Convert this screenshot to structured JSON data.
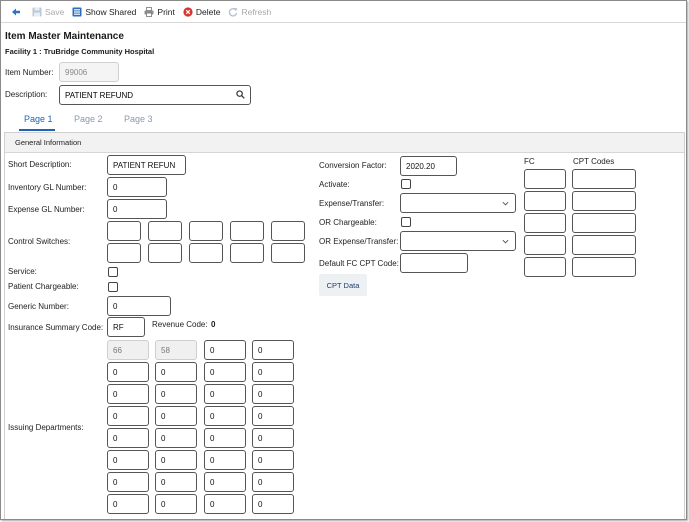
{
  "toolbar": {
    "back_label": "",
    "save_label": "Save",
    "show_shared_label": "Show Shared",
    "print_label": "Print",
    "delete_label": "Delete",
    "refresh_label": "Refresh"
  },
  "header": {
    "title": "Item Master Maintenance",
    "facility": "Facility 1 : TruBridge Community Hospital"
  },
  "item_number": {
    "label": "Item Number:",
    "value": "99006"
  },
  "description": {
    "label": "Description:",
    "value": "PATIENT REFUND"
  },
  "tabs": [
    {
      "label": "Page 1",
      "active": true
    },
    {
      "label": "Page 2",
      "active": false
    },
    {
      "label": "Page 3",
      "active": false
    }
  ],
  "section_title": "General Information",
  "left": {
    "short_description": {
      "label": "Short Description:",
      "value": "PATIENT REFUN"
    },
    "inventory_gl": {
      "label": "Inventory GL Number:",
      "value": "0"
    },
    "expense_gl": {
      "label": "Expense GL Number:",
      "value": "0"
    },
    "control_switches": {
      "label": "Control Switches:",
      "values": [
        "",
        "",
        "",
        "",
        "",
        "",
        "",
        "",
        "",
        ""
      ]
    },
    "service": {
      "label": "Service:",
      "checked": false
    },
    "patient_chargeable": {
      "label": "Patient Chargeable:",
      "checked": false
    },
    "generic_number": {
      "label": "Generic Number:",
      "value": "0"
    },
    "insurance_summary": {
      "label": "Insurance Summary Code:",
      "value": "RF"
    },
    "revenue_code": {
      "label": "Revenue Code:",
      "value": "0"
    },
    "issuing_departments": {
      "label": "Issuing Departments:",
      "rows": [
        [
          "66",
          "58",
          "0",
          "0"
        ],
        [
          "0",
          "0",
          "0",
          "0"
        ],
        [
          "0",
          "0",
          "0",
          "0"
        ],
        [
          "0",
          "0",
          "0",
          "0"
        ],
        [
          "0",
          "0",
          "0",
          "0"
        ],
        [
          "0",
          "0",
          "0",
          "0"
        ],
        [
          "0",
          "0",
          "0",
          "0"
        ],
        [
          "0",
          "0",
          "0",
          "0"
        ]
      ]
    }
  },
  "middle": {
    "conversion_factor": {
      "label": "Conversion Factor:",
      "value": "2020.20"
    },
    "activate": {
      "label": "Activate:",
      "checked": false
    },
    "expense_transfer": {
      "label": "Expense/Transfer:",
      "value": ""
    },
    "or_chargeable": {
      "label": "OR Chargeable:",
      "checked": false
    },
    "or_expense_transfer": {
      "label": "OR Expense/Transfer:",
      "value": ""
    },
    "default_fc_cpt": {
      "label": "Default FC CPT Code:",
      "value": ""
    },
    "cpt_data_button": "CPT Data"
  },
  "right": {
    "fc_header": "FC",
    "cpt_header": "CPT Codes",
    "rows": [
      {
        "fc": "",
        "cpt": ""
      },
      {
        "fc": "",
        "cpt": ""
      },
      {
        "fc": "",
        "cpt": ""
      },
      {
        "fc": "",
        "cpt": ""
      },
      {
        "fc": "",
        "cpt": ""
      }
    ]
  },
  "colors": {
    "accent": "#1e63b5",
    "delete": "#d9342b",
    "border": "#555555"
  }
}
